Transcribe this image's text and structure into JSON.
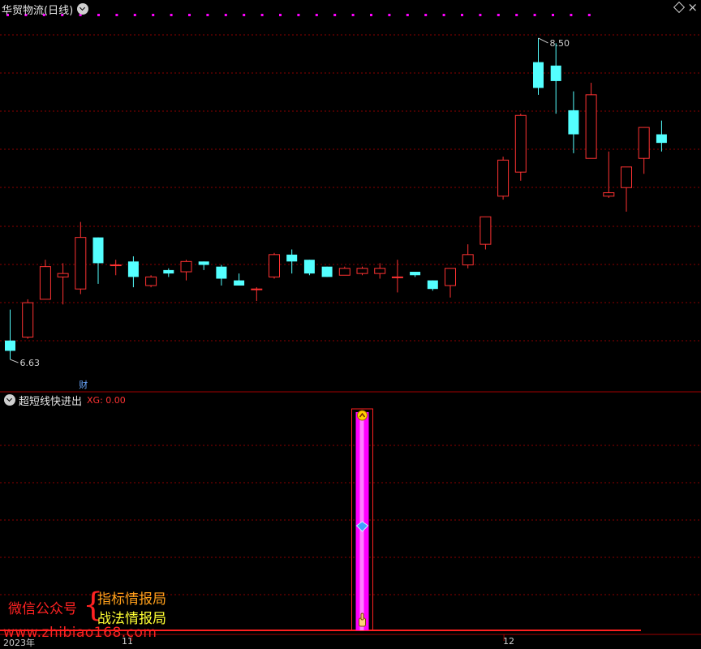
{
  "window": {
    "stock_title": "华贸物流(日线)",
    "indicator_name": "超短线快进出",
    "indicator_value": "XG: 0.00",
    "fin_marker": "财"
  },
  "watermark": {
    "public_account": "微信公众号",
    "brand_a": "指标情报局",
    "brand_b": "战法情报局",
    "site": "www.zhibiao168.com"
  },
  "axis": {
    "year_label": "2023年",
    "month_11": "11",
    "month_12": "12"
  },
  "price_labels": {
    "high": "8.50",
    "low": "6.63"
  },
  "colors": {
    "up": "#ff3232",
    "down": "#54ffff",
    "grid": "#8b0000",
    "signal_bar": "#ff00ff",
    "divider": "#a00000",
    "top_dots": "#ff00ff"
  },
  "icons": {
    "signal_top": "up-chevron-icon",
    "signal_mid": "blue-diamond-icon",
    "signal_bottom": "hand-pointer-icon"
  },
  "chart_data": {
    "type": "candlestick",
    "price_range": [
      6.55,
      8.58
    ],
    "high_label": 8.5,
    "low_label": 6.63,
    "candles": [
      {
        "o": 6.74,
        "h": 6.92,
        "l": 6.63,
        "c": 6.68
      },
      {
        "o": 6.76,
        "h": 6.98,
        "l": 6.75,
        "c": 6.96
      },
      {
        "o": 6.98,
        "h": 7.21,
        "l": 6.98,
        "c": 7.17
      },
      {
        "o": 7.11,
        "h": 7.19,
        "l": 6.95,
        "c": 7.13
      },
      {
        "o": 7.04,
        "h": 7.43,
        "l": 7.01,
        "c": 7.34
      },
      {
        "o": 7.34,
        "h": 7.34,
        "l": 7.07,
        "c": 7.19
      },
      {
        "o": 7.18,
        "h": 7.21,
        "l": 7.12,
        "c": 7.18
      },
      {
        "o": 7.2,
        "h": 7.23,
        "l": 7.05,
        "c": 7.11
      },
      {
        "o": 7.06,
        "h": 7.12,
        "l": 7.05,
        "c": 7.11
      },
      {
        "o": 7.15,
        "h": 7.16,
        "l": 7.11,
        "c": 7.13
      },
      {
        "o": 7.14,
        "h": 7.21,
        "l": 7.09,
        "c": 7.2
      },
      {
        "o": 7.2,
        "h": 7.2,
        "l": 7.15,
        "c": 7.18
      },
      {
        "o": 7.17,
        "h": 7.18,
        "l": 7.06,
        "c": 7.1
      },
      {
        "o": 7.09,
        "h": 7.13,
        "l": 7.06,
        "c": 7.06
      },
      {
        "o": 7.04,
        "h": 7.05,
        "l": 6.97,
        "c": 7.04
      },
      {
        "o": 7.11,
        "h": 7.25,
        "l": 7.1,
        "c": 7.24
      },
      {
        "o": 7.24,
        "h": 7.27,
        "l": 7.13,
        "c": 7.2
      },
      {
        "o": 7.21,
        "h": 7.21,
        "l": 7.12,
        "c": 7.13
      },
      {
        "o": 7.17,
        "h": 7.17,
        "l": 7.11,
        "c": 7.11
      },
      {
        "o": 7.12,
        "h": 7.17,
        "l": 7.12,
        "c": 7.16
      },
      {
        "o": 7.13,
        "h": 7.17,
        "l": 7.12,
        "c": 7.16
      },
      {
        "o": 7.13,
        "h": 7.19,
        "l": 7.1,
        "c": 7.16
      },
      {
        "o": 7.11,
        "h": 7.21,
        "l": 7.02,
        "c": 7.11
      },
      {
        "o": 7.14,
        "h": 7.14,
        "l": 7.11,
        "c": 7.12
      },
      {
        "o": 7.09,
        "h": 7.09,
        "l": 7.03,
        "c": 7.04
      },
      {
        "o": 7.06,
        "h": 7.11,
        "l": 6.99,
        "c": 7.16
      },
      {
        "o": 7.18,
        "h": 7.3,
        "l": 7.16,
        "c": 7.24
      },
      {
        "o": 7.3,
        "h": 7.46,
        "l": 7.27,
        "c": 7.46
      },
      {
        "o": 7.58,
        "h": 7.81,
        "l": 7.56,
        "c": 7.79
      },
      {
        "o": 7.72,
        "h": 8.06,
        "l": 7.67,
        "c": 8.05
      },
      {
        "o": 8.36,
        "h": 8.5,
        "l": 8.17,
        "c": 8.21
      },
      {
        "o": 8.34,
        "h": 8.47,
        "l": 8.06,
        "c": 8.25
      },
      {
        "o": 8.08,
        "h": 8.19,
        "l": 7.83,
        "c": 7.94
      },
      {
        "o": 7.8,
        "h": 8.24,
        "l": 7.8,
        "c": 8.17
      },
      {
        "o": 7.58,
        "h": 7.84,
        "l": 7.57,
        "c": 7.6
      },
      {
        "o": 7.63,
        "h": 7.75,
        "l": 7.49,
        "c": 7.75
      },
      {
        "o": 7.8,
        "h": 7.89,
        "l": 7.71,
        "c": 7.98
      },
      {
        "o": 7.94,
        "h": 8.02,
        "l": 7.84,
        "c": 7.89
      }
    ],
    "candles_fix_note_free": true,
    "indicator": {
      "name": "超短线快进出",
      "XG": 0.0,
      "signal_bar_index": 20
    }
  }
}
